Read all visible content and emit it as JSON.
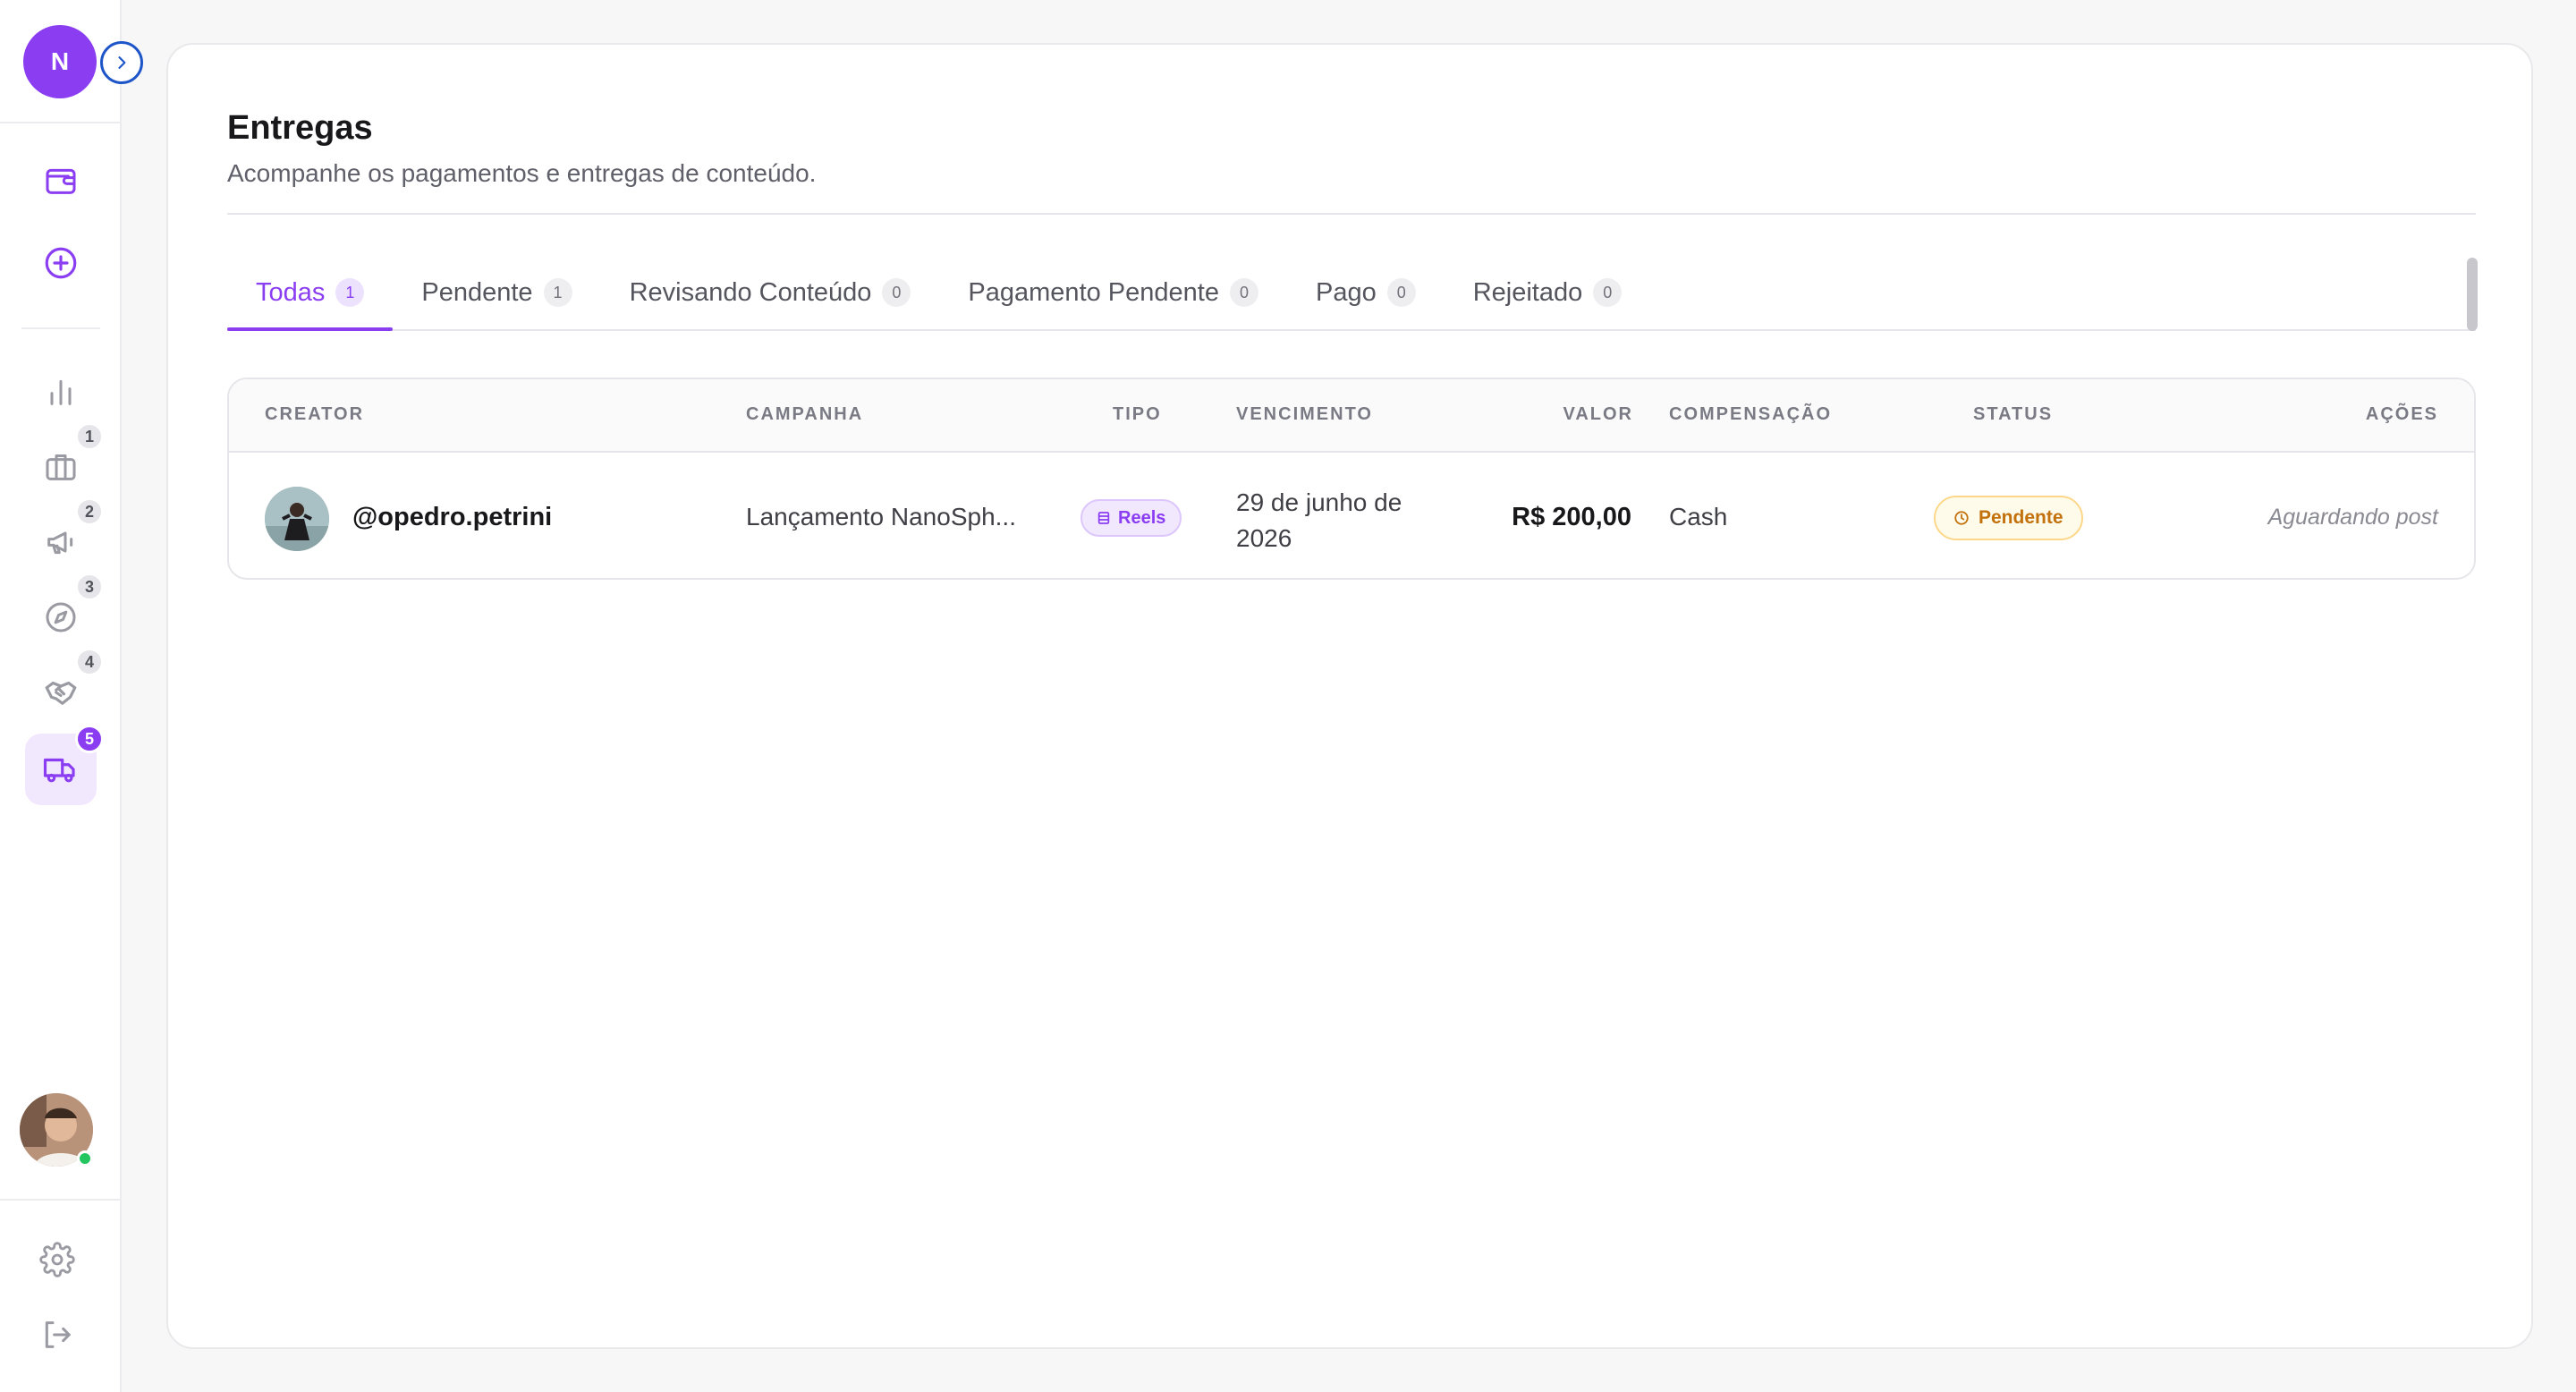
{
  "sidebar": {
    "logo_initial": "N",
    "nav": [
      {
        "id": "wallet",
        "icon": "wallet-icon"
      },
      {
        "id": "add",
        "icon": "plus-circle-icon"
      },
      {
        "id": "analytics",
        "icon": "bar-chart-icon"
      },
      {
        "id": "briefcase",
        "icon": "briefcase-icon",
        "badge": "1"
      },
      {
        "id": "campaigns",
        "icon": "megaphone-icon",
        "badge": "2"
      },
      {
        "id": "explore",
        "icon": "compass-icon",
        "badge": "3"
      },
      {
        "id": "deals",
        "icon": "handshake-icon",
        "badge": "4"
      },
      {
        "id": "deliveries",
        "icon": "truck-icon",
        "badge": "5",
        "active": true
      }
    ]
  },
  "page": {
    "title": "Entregas",
    "subtitle": "Acompanhe os pagamentos e entregas de conteúdo."
  },
  "tabs": [
    {
      "label": "Todas",
      "count": "1",
      "active": true
    },
    {
      "label": "Pendente",
      "count": "1"
    },
    {
      "label": "Revisando Conteúdo",
      "count": "0"
    },
    {
      "label": "Pagamento Pendente",
      "count": "0"
    },
    {
      "label": "Pago",
      "count": "0"
    },
    {
      "label": "Rejeitado",
      "count": "0"
    }
  ],
  "table": {
    "headers": {
      "creator": "CREATOR",
      "campaign": "CAMPANHA",
      "type": "TIPO",
      "due": "VENCIMENTO",
      "value": "VALOR",
      "compensation": "COMPENSAÇÃO",
      "status": "STATUS",
      "actions": "AÇÕES"
    },
    "rows": [
      {
        "creator": "@opedro.petrini",
        "campaign": "Lançamento NanoSph...",
        "type": "Reels",
        "due": "29 de junho de 2026",
        "value": "R$ 200,00",
        "compensation": "Cash",
        "status": "Pendente",
        "action": "Aguardando post"
      }
    ]
  },
  "colors": {
    "accent": "#8b3df2",
    "status_pending": "#c2710c",
    "online": "#22c55e"
  }
}
